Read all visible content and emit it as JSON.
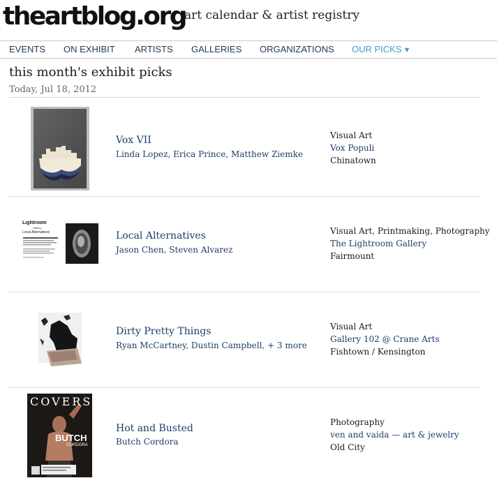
{
  "header": {
    "logo": "theartblog.org",
    "tagline": "art calendar & artist registry"
  },
  "nav": {
    "items": [
      "EVENTS",
      "ON EXHIBIT",
      "ARTISTS",
      "GALLERIES",
      "ORGANIZATIONS",
      "OUR PICKS"
    ],
    "active": "OUR PICKS"
  },
  "page": {
    "title": "this month's exhibit picks",
    "date": "Today, Jul 18, 2012"
  },
  "exhibits": [
    {
      "title": "Vox VII",
      "artists": "Linda Lopez, Erica Prince, Matthew Ziemke",
      "category": "Visual Art",
      "venue": "Vox Populi",
      "neighborhood": "Chinatown"
    },
    {
      "title": "Local Alternatives",
      "artists": "Jason Chen, Steven Alvarez",
      "category": "Visual Art, Printmaking, Photography",
      "venue": "The Lightroom Gallery",
      "neighborhood": "Fairmount"
    },
    {
      "title": "Dirty Pretty Things",
      "artists": "Ryan McCartney, Dustin Campbell, + 3 more",
      "category": "Visual Art",
      "venue": "Gallery 102 @ Crane Arts",
      "neighborhood": "Fishtown / Kensington"
    },
    {
      "title": "Hot and Busted",
      "artists": "Butch Cordora",
      "category": "Photography",
      "venue": "ven and vaida — art & jewelry",
      "neighborhood": "Old City"
    }
  ],
  "thumbnails": {
    "lightroom_logo": "Lightroom",
    "lightroom_logo_sub": "Gallery",
    "lightroom_heading": "Local Alternatives",
    "covers_title": "COVERS",
    "covers_name": "BUTCH",
    "covers_subname": "CORDORA"
  }
}
